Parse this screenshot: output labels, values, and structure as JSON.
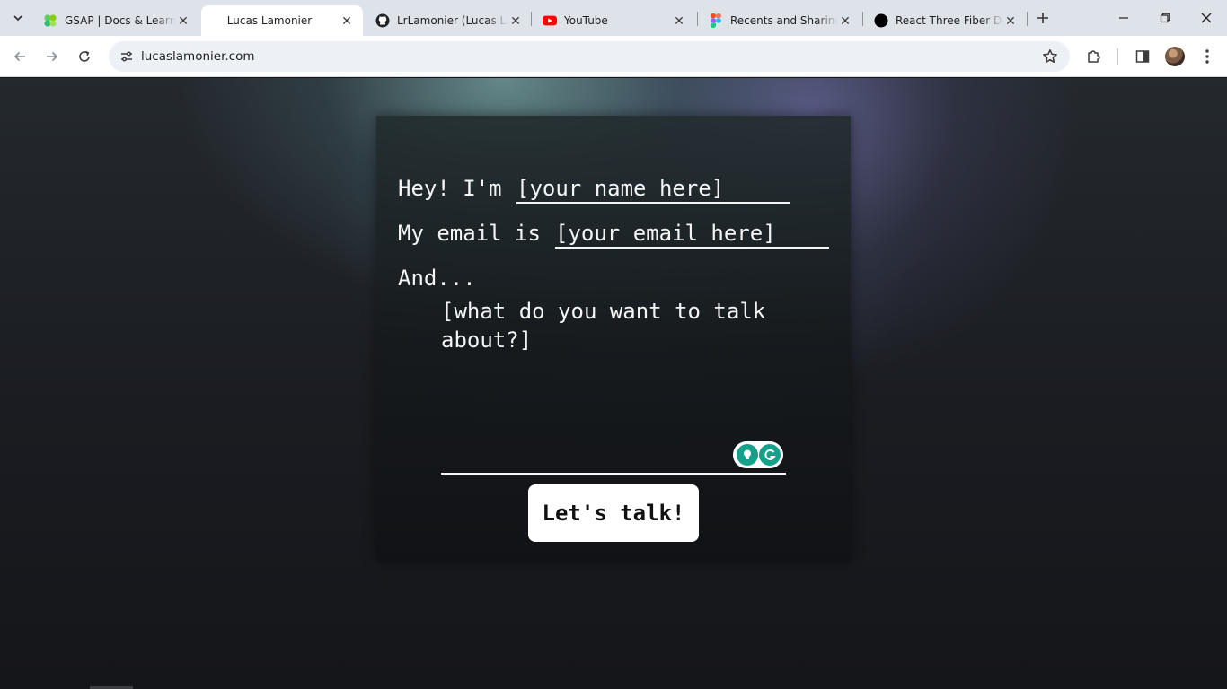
{
  "browser": {
    "tabs": [
      {
        "title": "GSAP | Docs & Learning",
        "favicon": "gsap-icon",
        "active": false
      },
      {
        "title": "Lucas Lamonier",
        "favicon": "none",
        "active": true
      },
      {
        "title": "LrLamonier (Lucas Lamonier)",
        "favicon": "github-icon",
        "active": false
      },
      {
        "title": "YouTube",
        "favicon": "youtube-icon",
        "active": false
      },
      {
        "title": "Recents and Sharing",
        "favicon": "figma-icon",
        "active": false
      },
      {
        "title": "React Three Fiber Documentation",
        "favicon": "r3f-icon",
        "active": false
      }
    ],
    "address": {
      "url": "lucaslamonier.com"
    },
    "colors": {
      "tabstrip": "#dee3ea",
      "toolbar": "#ffffff",
      "omnibox": "#edf1f6"
    }
  },
  "form": {
    "name_prefix": "Hey! I'm",
    "name_placeholder": "[your name here]",
    "email_prefix": "My email is",
    "email_placeholder": "[your email here]",
    "message_prefix": "And...",
    "message_placeholder": "[what do you want to talk about?]",
    "submit_label": "Let's talk!"
  },
  "colors": {
    "text": "#f3f4f5",
    "button_bg": "#ffffff",
    "grammarly": "#15a08a"
  }
}
